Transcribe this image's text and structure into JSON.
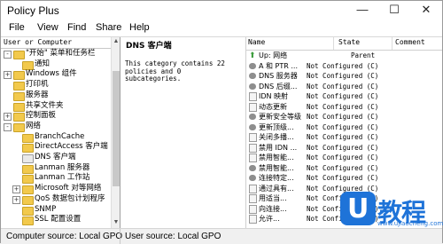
{
  "window": {
    "title": "Policy Plus",
    "minimize": "—",
    "maximize": "☐",
    "close": "✕"
  },
  "menu": [
    "File",
    "View",
    "Find",
    "Share",
    "Help"
  ],
  "left_pane": {
    "header": "User or Computer",
    "tree": [
      {
        "label": "\"开始\" 菜单和任务栏",
        "level": 0,
        "expander": "-",
        "icon": "folder"
      },
      {
        "label": "通知",
        "level": 1,
        "expander": "",
        "icon": "folder"
      },
      {
        "label": "Windows 组件",
        "level": 0,
        "expander": "+",
        "icon": "folder"
      },
      {
        "label": "打印机",
        "level": 0,
        "expander": "",
        "icon": "folder"
      },
      {
        "label": "服务器",
        "level": 0,
        "expander": "",
        "icon": "folder"
      },
      {
        "label": "共享文件夹",
        "level": 0,
        "expander": "",
        "icon": "folder"
      },
      {
        "label": "控制面板",
        "level": 0,
        "expander": "+",
        "icon": "folder"
      },
      {
        "label": "网络",
        "level": 0,
        "expander": "-",
        "icon": "folder"
      },
      {
        "label": "BranchCache",
        "level": 1,
        "expander": "",
        "icon": "folder"
      },
      {
        "label": "DirectAccess 客户端",
        "level": 1,
        "expander": "",
        "icon": "folder"
      },
      {
        "label": "DNS 客户端",
        "level": 1,
        "expander": "",
        "icon": "doc"
      },
      {
        "label": "Lanman 服务器",
        "level": 1,
        "expander": "",
        "icon": "folder"
      },
      {
        "label": "Lanman 工作站",
        "level": 1,
        "expander": "",
        "icon": "folder"
      },
      {
        "label": "Microsoft 对等网络",
        "level": 1,
        "expander": "+",
        "icon": "folder"
      },
      {
        "label": "QoS 数据包计划程序",
        "level": 1,
        "expander": "+",
        "icon": "folder"
      },
      {
        "label": "SNMP",
        "level": 1,
        "expander": "",
        "icon": "folder"
      },
      {
        "label": "SSL 配置设置",
        "level": 1,
        "expander": "",
        "icon": "folder"
      }
    ]
  },
  "middle_pane": {
    "title": "DNS 客户端",
    "description": "This category contains 22 policies and 0 subcategories."
  },
  "right_pane": {
    "columns": [
      "Name",
      "State",
      "Comment"
    ],
    "rows": [
      {
        "name": "Up: 网络",
        "state": "Parent",
        "icon": "up"
      },
      {
        "name": "A 和 PTR ...",
        "state": "Not Configured (C)",
        "icon": "policy"
      },
      {
        "name": "DNS 服务器",
        "state": "Not Configured (C)",
        "icon": "policy"
      },
      {
        "name": "DNS 后缀...",
        "state": "Not Configured (C)",
        "icon": "policy"
      },
      {
        "name": "IDN 映射",
        "state": "Not Configured (C)",
        "icon": "doc"
      },
      {
        "name": "动态更新",
        "state": "Not Configured (C)",
        "icon": "doc"
      },
      {
        "name": "更新安全等级",
        "state": "Not Configured (C)",
        "icon": "policy"
      },
      {
        "name": "更新顶级...",
        "state": "Not Configured (C)",
        "icon": "policy"
      },
      {
        "name": "关闭多播...",
        "state": "Not Configured (C)",
        "icon": "doc"
      },
      {
        "name": "禁用 IDN ...",
        "state": "Not Configured (C)",
        "icon": "doc"
      },
      {
        "name": "禁用智能...",
        "state": "Not Configured (C)",
        "icon": "doc"
      },
      {
        "name": "禁用智能...",
        "state": "Not Configured (C)",
        "icon": "policy"
      },
      {
        "name": "连接特定...",
        "state": "Not Configured (C)",
        "icon": "policy"
      },
      {
        "name": "通过具有...",
        "state": "Not Configured (C)",
        "icon": "doc"
      },
      {
        "name": "用适当...",
        "state": "Not Configured (C)",
        "icon": "doc"
      },
      {
        "name": "向连接...",
        "state": "Not Configured (C)",
        "icon": "doc"
      },
      {
        "name": "允许...",
        "state": "Not Configured (C)",
        "icon": "doc"
      }
    ]
  },
  "status": {
    "computer_source": "Computer source:  Local GPO",
    "user_source": "User source:  Local GPO"
  },
  "watermark": {
    "badge": "U",
    "text": "教程",
    "url": "www.ujiaocheng.com"
  }
}
